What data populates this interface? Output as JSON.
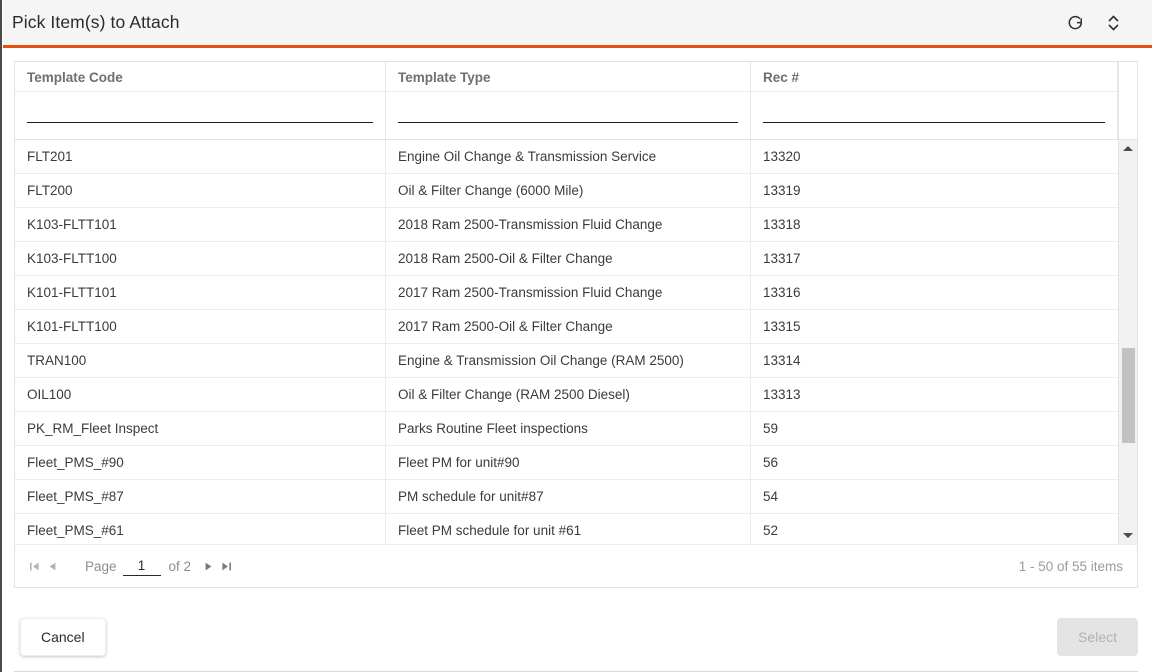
{
  "titlebar": {
    "title": "Pick Item(s) to Attach",
    "refresh_icon": "refresh-icon",
    "resize_icon": "expand-collapse-icon"
  },
  "grid": {
    "columns": [
      {
        "key": "template_code",
        "label": "Template Code",
        "filter_value": "",
        "filter_placeholder": ""
      },
      {
        "key": "template_type",
        "label": "Template Type",
        "filter_value": "",
        "filter_placeholder": ""
      },
      {
        "key": "rec_no",
        "label": "Rec #",
        "filter_value": "",
        "filter_placeholder": ""
      }
    ],
    "rows": [
      {
        "template_code": "FLT201",
        "template_type": "Engine Oil Change & Transmission Service",
        "rec_no": "13320"
      },
      {
        "template_code": "FLT200",
        "template_type": "Oil & Filter Change (6000 Mile)",
        "rec_no": "13319"
      },
      {
        "template_code": "K103-FLTT101",
        "template_type": "2018 Ram 2500-Transmission Fluid Change",
        "rec_no": "13318"
      },
      {
        "template_code": "K103-FLTT100",
        "template_type": "2018 Ram 2500-Oil & Filter Change",
        "rec_no": "13317"
      },
      {
        "template_code": "K101-FLTT101",
        "template_type": "2017 Ram 2500-Transmission Fluid Change",
        "rec_no": "13316"
      },
      {
        "template_code": "K101-FLTT100",
        "template_type": "2017 Ram 2500-Oil & Filter Change",
        "rec_no": "13315"
      },
      {
        "template_code": "TRAN100",
        "template_type": "Engine & Transmission Oil Change (RAM 2500)",
        "rec_no": "13314"
      },
      {
        "template_code": "OIL100",
        "template_type": "Oil & Filter Change (RAM 2500 Diesel)",
        "rec_no": "13313"
      },
      {
        "template_code": "PK_RM_Fleet Inspect",
        "template_type": "Parks Routine Fleet inspections",
        "rec_no": "59"
      },
      {
        "template_code": "Fleet_PMS_#90",
        "template_type": "Fleet PM for unit#90",
        "rec_no": "56"
      },
      {
        "template_code": "Fleet_PMS_#87",
        "template_type": "PM schedule for unit#87",
        "rec_no": "54"
      },
      {
        "template_code": "Fleet_PMS_#61",
        "template_type": "Fleet PM schedule for unit #61",
        "rec_no": "52"
      }
    ],
    "scrollbar": {
      "up_arrow_icon": "caret-up-icon",
      "down_arrow_icon": "caret-down-icon"
    }
  },
  "pager": {
    "first_icon": "page-first-icon",
    "prev_icon": "page-prev-icon",
    "next_icon": "page-next-icon",
    "last_icon": "page-last-icon",
    "page_label": "Page",
    "page_value": "1",
    "of_label": "of 2",
    "items_summary": "1 - 50 of 55 items"
  },
  "footer": {
    "cancel_label": "Cancel",
    "select_label": "Select"
  },
  "colors": {
    "accent": "#e8500f",
    "titlebar_bg": "#f5f5f5",
    "grid_border": "#e2e2e2",
    "text": "#3b3b3b",
    "muted": "#8c8c8c",
    "disabled_bg": "#e4e4e4",
    "scroll_thumb": "#c2c2c2"
  }
}
